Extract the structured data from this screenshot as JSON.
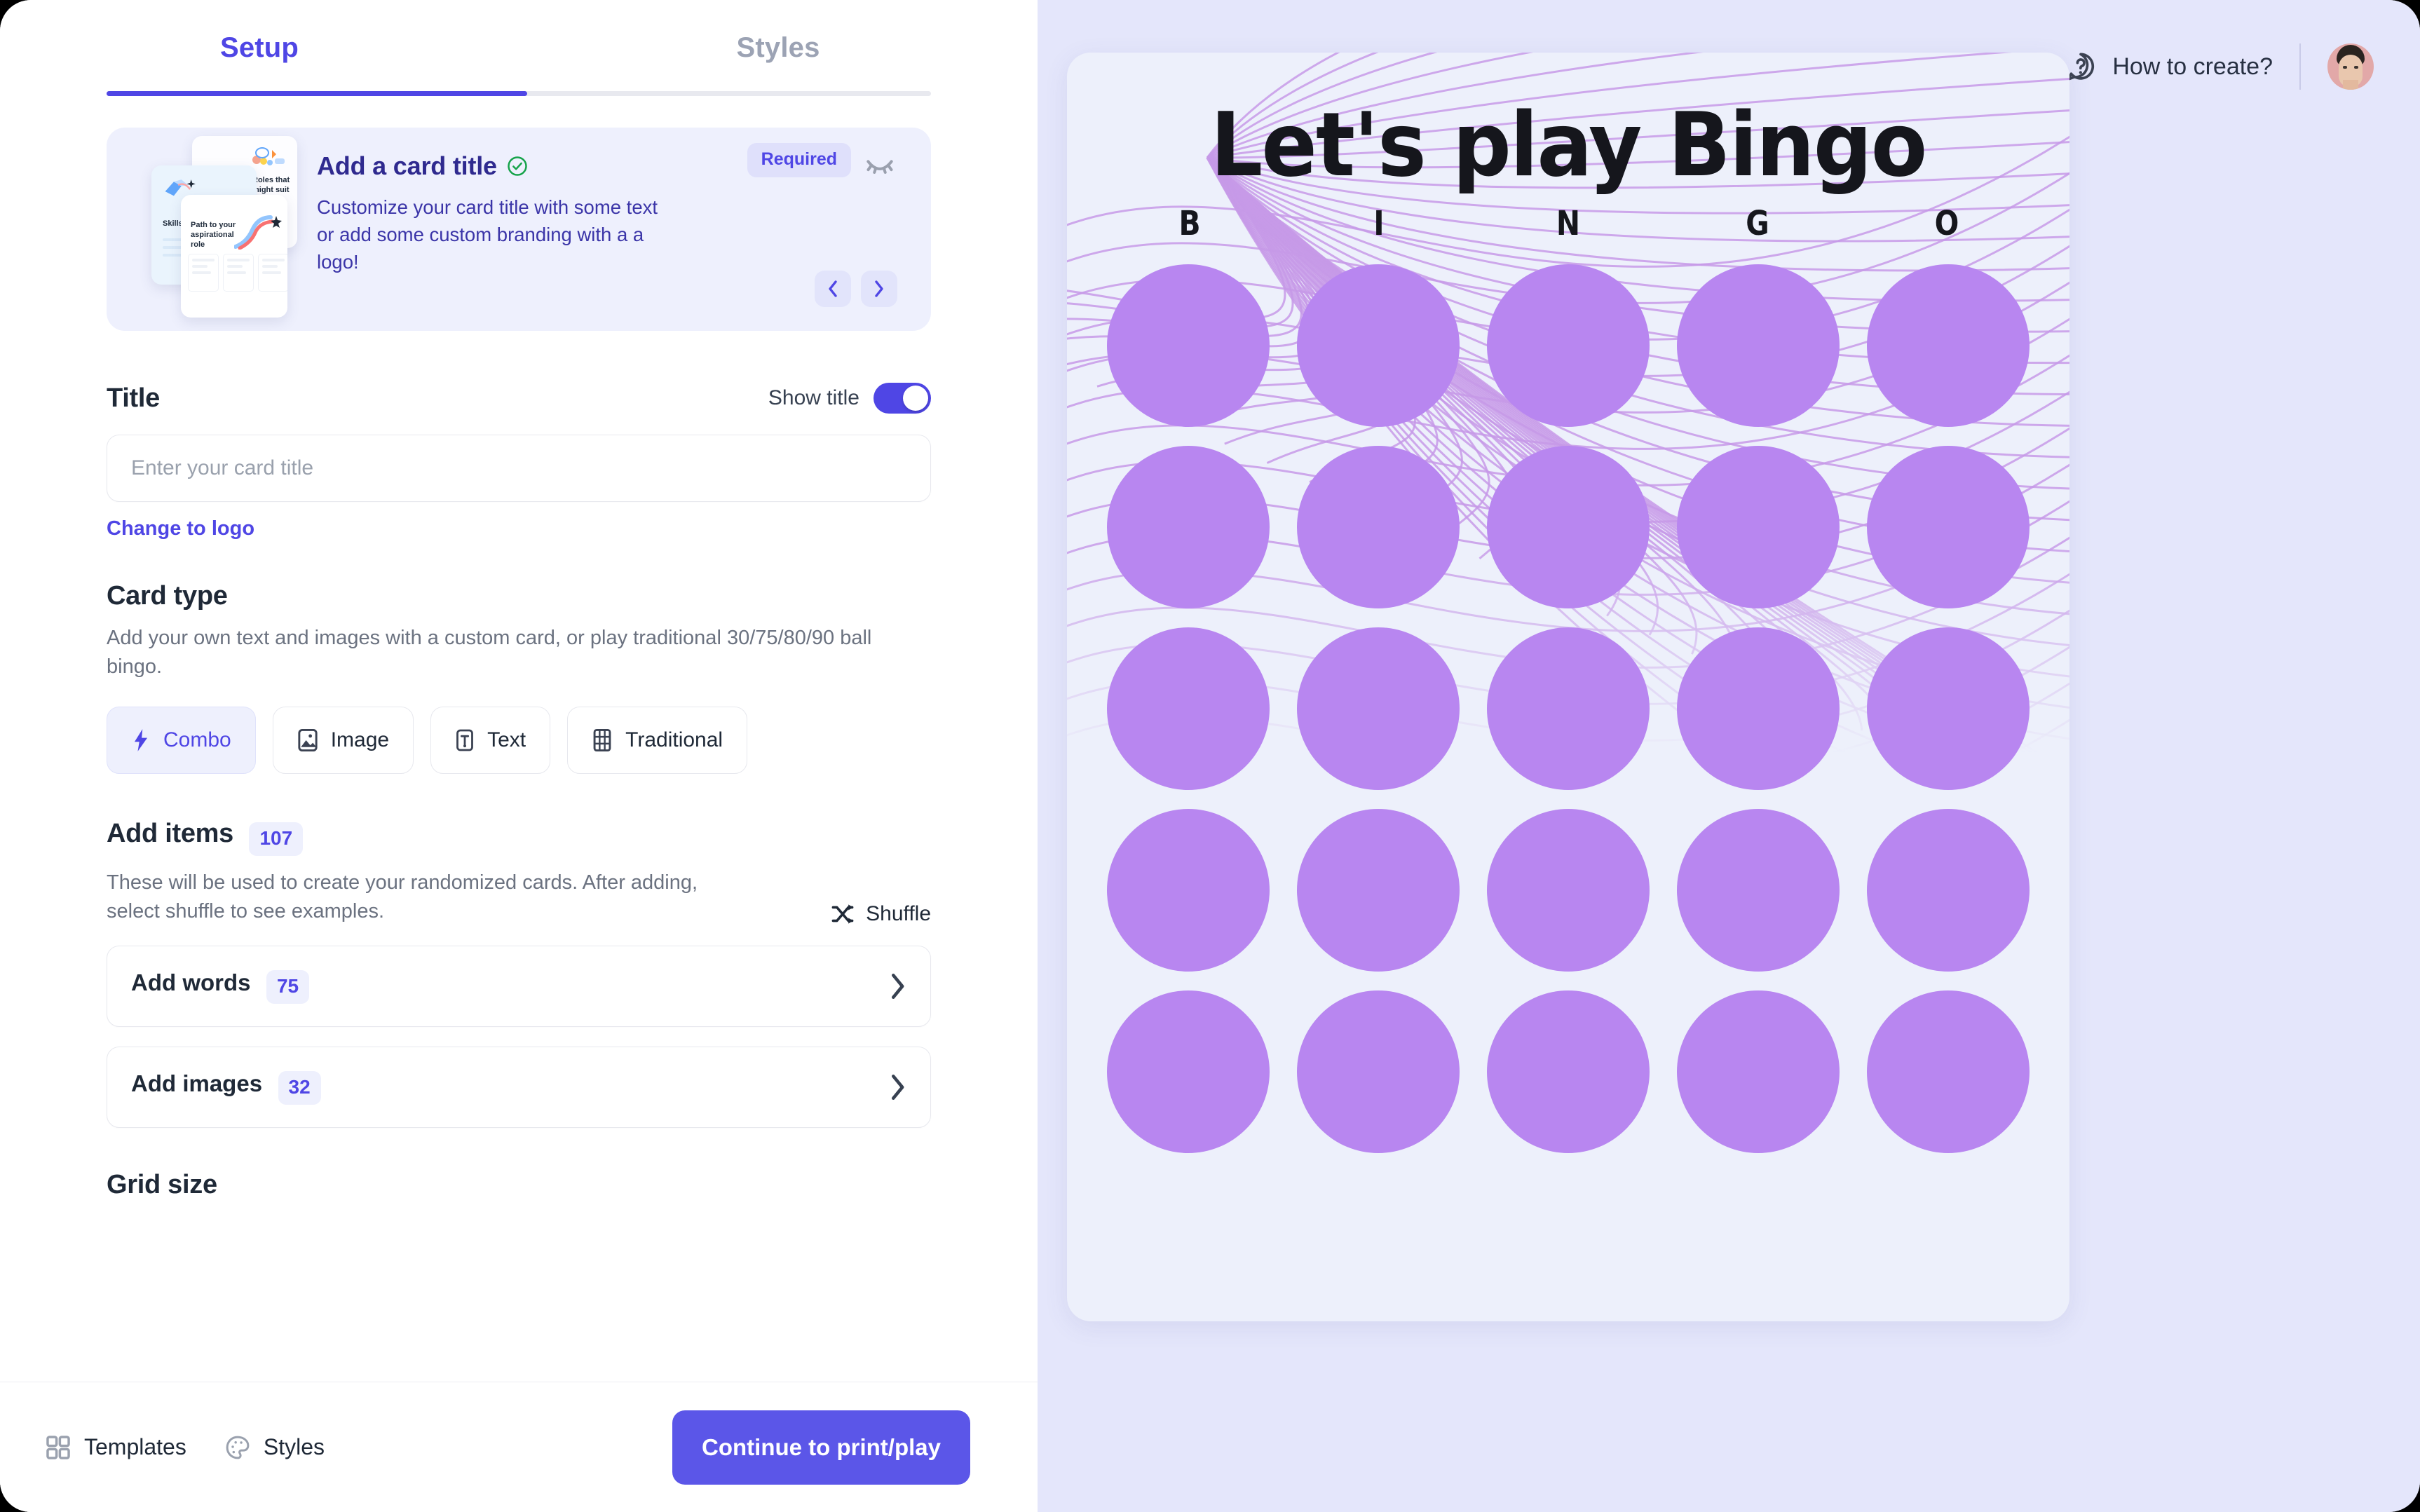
{
  "tabs": [
    {
      "label": "Setup",
      "active": true
    },
    {
      "label": "Styles",
      "active": false
    }
  ],
  "info_banner": {
    "title": "Add a card title",
    "status_icon": "check-circle-icon",
    "description": "Customize your card title with some text or add some custom branding with a a logo!",
    "badge": "Required",
    "hide_icon": "eye-off-icon",
    "prev_icon": "chevron-left-icon",
    "next_icon": "chevron-right-icon",
    "thumbnails": [
      {
        "caption": "Roles that might suit you"
      },
      {
        "caption": "Skills recomm"
      },
      {
        "caption": "Path to your aspirational role"
      }
    ]
  },
  "title_section": {
    "heading": "Title",
    "show_title_label": "Show title",
    "show_title_on": true,
    "input_value": "",
    "input_placeholder": "Enter your card title",
    "change_link": "Change to logo"
  },
  "card_type": {
    "heading": "Card type",
    "description": "Add your own text and images with a custom card, or play traditional 30/75/80/90 ball bingo.",
    "options": [
      {
        "label": "Combo",
        "icon": "bolt-icon",
        "active": true
      },
      {
        "label": "Image",
        "icon": "image-icon",
        "active": false
      },
      {
        "label": "Text",
        "icon": "text-box-icon",
        "active": false
      },
      {
        "label": "Traditional",
        "icon": "grid-icon",
        "active": false
      }
    ]
  },
  "add_items": {
    "heading": "Add items",
    "count": "107",
    "description": "These will be used to create your randomized cards. After adding, select shuffle to see examples.",
    "shuffle_label": "Shuffle",
    "shuffle_icon": "shuffle-icon",
    "rows": [
      {
        "label": "Add words",
        "count": "75",
        "chevron": "chevron-right-icon"
      },
      {
        "label": "Add images",
        "count": "32",
        "chevron": "chevron-right-icon"
      }
    ]
  },
  "grid_size": {
    "heading": "Grid size"
  },
  "footer": {
    "templates_label": "Templates",
    "templates_icon": "grid-squares-icon",
    "styles_label": "Styles",
    "styles_icon": "palette-icon",
    "cta_label": "Continue to print/play"
  },
  "preview_header": {
    "help_label": "How to create?",
    "help_icon": "question-bubble-icon",
    "avatar": "user-avatar"
  },
  "bingo_preview": {
    "title": "Let's play Bingo",
    "letters": [
      "B",
      "I",
      "N",
      "G",
      "O"
    ],
    "rows": 5,
    "cols": 5,
    "dot_color": "#b886f0",
    "card_bg": "#edf0fb",
    "panel_bg": "#e4e6fb"
  },
  "colors": {
    "accent": "#4f46e5",
    "cta": "#5b56e8",
    "badge_bg": "#dfe0fb",
    "banner_bg": "#eef0fd",
    "text_dark": "#1f2937",
    "text_muted": "#6b7280",
    "swirl": "#c79ae8"
  }
}
